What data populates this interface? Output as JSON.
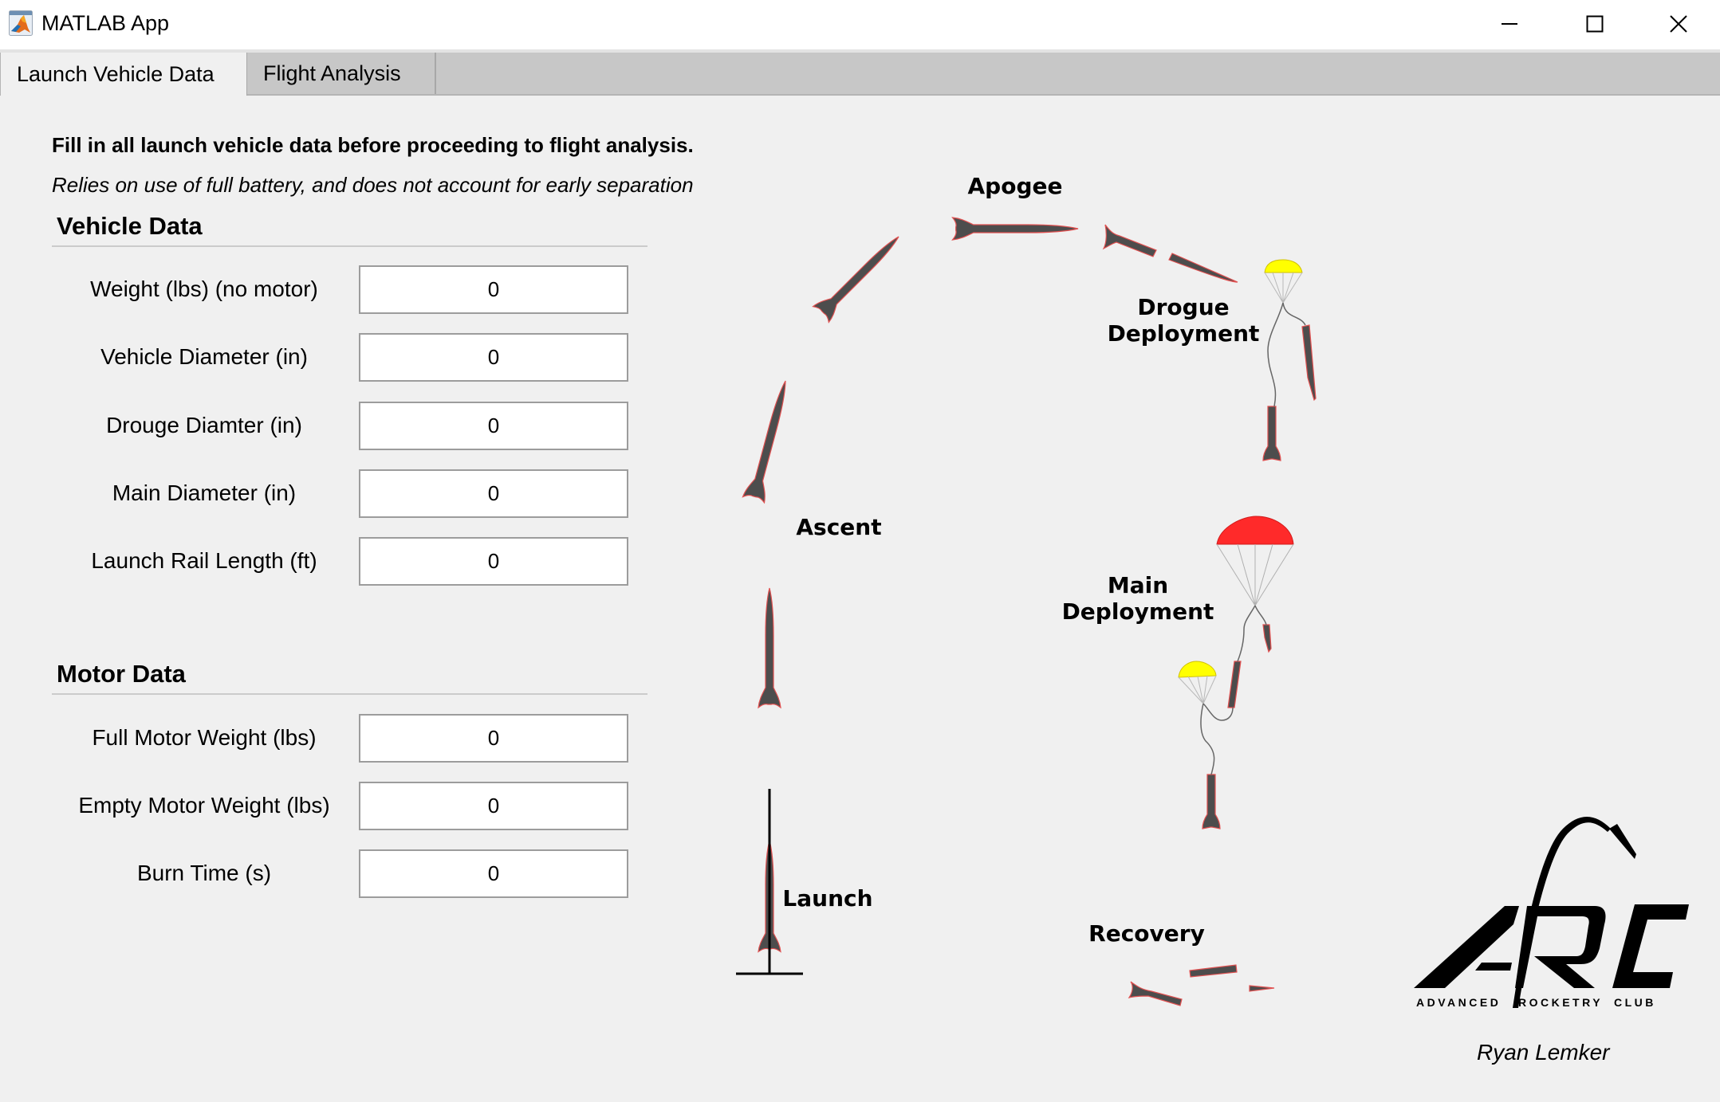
{
  "window": {
    "title": "MATLAB App",
    "icon": "matlab-logo-icon",
    "controls": [
      {
        "name": "minimize",
        "icon": "minimize-icon"
      },
      {
        "name": "maximize",
        "icon": "maximize-icon"
      },
      {
        "name": "close",
        "icon": "close-icon"
      }
    ]
  },
  "tabs": [
    {
      "label": "Launch Vehicle Data",
      "active": true
    },
    {
      "label": "Flight Analysis",
      "active": false
    }
  ],
  "instructions": {
    "primary": "Fill in all launch vehicle data before proceeding to flight analysis.",
    "secondary": "Relies on use of full battery, and does not account for early separation"
  },
  "vehicle_data": {
    "title": "Vehicle Data",
    "fields": [
      {
        "label": "Weight (lbs) (no motor)",
        "value": "0"
      },
      {
        "label": "Vehicle Diameter (in)",
        "value": "0"
      },
      {
        "label": "Drouge Diamter (in)",
        "value": "0"
      },
      {
        "label": "Main Diameter (in)",
        "value": "0"
      },
      {
        "label": "Launch Rail Length (ft)",
        "value": "0"
      }
    ]
  },
  "motor_data": {
    "title": "Motor Data",
    "fields": [
      {
        "label": "Full Motor Weight (lbs)",
        "value": "0"
      },
      {
        "label": "Empty Motor Weight (lbs)",
        "value": "0"
      },
      {
        "label": "Burn Time (s)",
        "value": "0"
      }
    ]
  },
  "flight_diagram": {
    "stages": {
      "apogee": "Apogee",
      "ascent": "Ascent",
      "launch": "Launch",
      "drogue_line1": "Drogue",
      "drogue_line2": "Deployment",
      "main_line1": "Main",
      "main_line2": "Deployment",
      "recovery": "Recovery"
    },
    "colors": {
      "rocket_body": "#4d4d4d",
      "rocket_outline": "#e05050",
      "drogue_chute": "#ffff00",
      "main_chute": "#ff2a2a"
    }
  },
  "logo": {
    "letters": "ARC",
    "words": [
      "ADVANCED",
      "ROCKETRY",
      "CLUB"
    ]
  },
  "author": "Ryan Lemker"
}
